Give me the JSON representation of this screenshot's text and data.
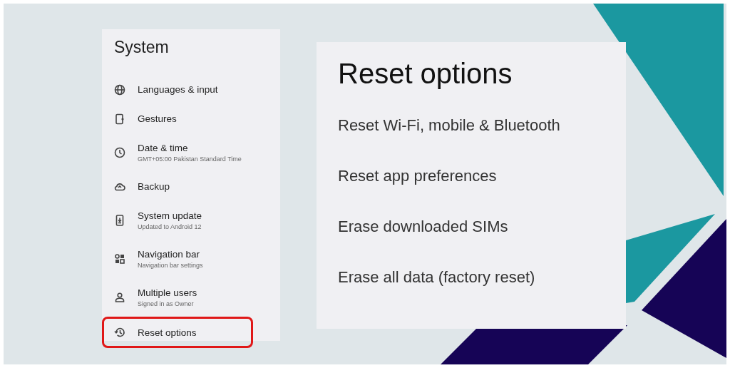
{
  "system_panel": {
    "title": "System",
    "items": [
      {
        "title": "Languages & input",
        "highlighted": false
      },
      {
        "title": "Gestures",
        "highlighted": false
      },
      {
        "title": "Date & time",
        "subtitle": "GMT+05:00 Pakistan Standard Time",
        "highlighted": false
      },
      {
        "title": "Backup",
        "highlighted": false
      },
      {
        "title": "System update",
        "subtitle": "Updated to Android 12",
        "highlighted": false
      },
      {
        "title": "Navigation bar",
        "subtitle": "Navigation bar settings",
        "highlighted": false
      },
      {
        "title": "Multiple users",
        "subtitle": "Signed in as Owner",
        "highlighted": false
      },
      {
        "title": "Reset options",
        "highlighted": true
      }
    ]
  },
  "reset_panel": {
    "title": "Reset options",
    "items": [
      {
        "title": "Reset Wi-Fi, mobile & Bluetooth"
      },
      {
        "title": "Reset app preferences"
      },
      {
        "title": "Erase downloaded SIMs"
      },
      {
        "title": "Erase all data (factory reset)"
      }
    ]
  }
}
